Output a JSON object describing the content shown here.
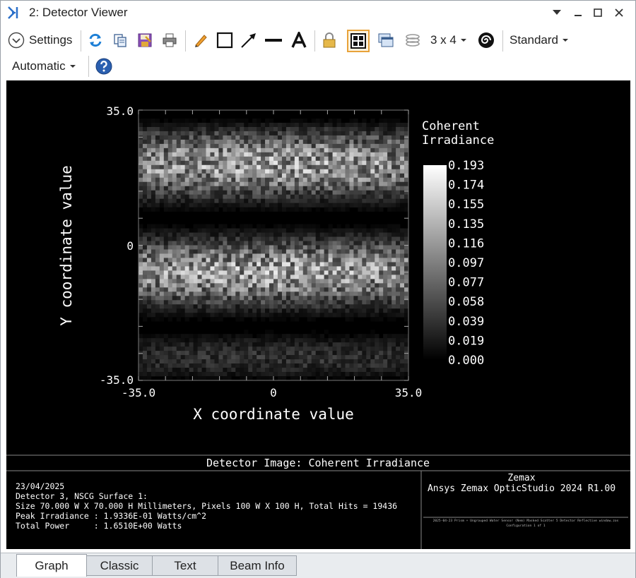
{
  "window": {
    "title": "2: Detector Viewer"
  },
  "toolbar": {
    "settings_label": "Settings",
    "layout_label": "3 x 4",
    "standard_label": "Standard",
    "automatic_label": "Automatic",
    "icons": [
      "refresh-icon",
      "copy-icon",
      "save-icon",
      "print-icon",
      "pencil-icon",
      "rectangle-icon",
      "arrow-icon",
      "line-icon",
      "text-icon",
      "lock-icon",
      "grid-icon",
      "window-icon",
      "layers-icon",
      "spiral-icon",
      "help-icon"
    ]
  },
  "plot": {
    "x_axis_label": "X coordinate value",
    "y_axis_label": "Y coordinate value",
    "x_ticks": [
      "-35.0",
      "0",
      "35.0"
    ],
    "y_ticks": [
      "35.0",
      "0",
      "-35.0"
    ],
    "colorbar_title_line1": "Coherent",
    "colorbar_title_line2": "Irradiance",
    "colorbar_ticks": [
      "0.193",
      "0.174",
      "0.155",
      "0.135",
      "0.116",
      "0.097",
      "0.077",
      "0.058",
      "0.039",
      "0.019",
      "0.000"
    ],
    "caption": "Detector Image: Coherent Irradiance"
  },
  "info": {
    "date": "23/04/2025",
    "detector": "Detector 3, NSCG Surface 1:",
    "size": "Size 70.000 W X 70.000 H Millimeters, Pixels 100 W X 100 H, Total Hits = 19436",
    "peak": "Peak Irradiance : 1.9336E-01 Watts/cm^2",
    "power": "Total Power     : 1.6510E+00 Watts",
    "brand": "Zemax",
    "product": "Ansys Zemax OpticStudio 2024 R1.00",
    "file_line1": "2025-04-23 Prism + Ungrouped Water Sensor (Nem) Masked Scatter 5 Detector Reflective window.zos",
    "file_line2": "Configuration 1 of 1"
  },
  "tabs": [
    "Graph",
    "Classic",
    "Text",
    "Beam Info"
  ],
  "colors": {
    "plot_bg": "#000000",
    "text_on_plot": "#ffffff",
    "accent_border": "#e8a33a"
  }
}
